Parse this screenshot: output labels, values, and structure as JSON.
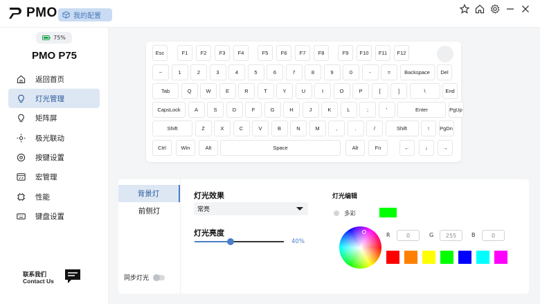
{
  "header": {
    "brand": "PMO",
    "config_label": "我的配置",
    "window_icons": [
      "pin-icon",
      "home-icon",
      "settings-icon",
      "minimize-icon",
      "close-icon"
    ]
  },
  "sidebar": {
    "battery": "75%",
    "device_name": "PMO P75",
    "items": [
      {
        "label": "返回首页",
        "icon": "home-icon"
      },
      {
        "label": "灯光管理",
        "icon": "bulb-icon",
        "active": true
      },
      {
        "label": "矩阵屏",
        "icon": "matrix-bulb-icon"
      },
      {
        "label": "极光联动",
        "icon": "sun-icon"
      },
      {
        "label": "按键设置",
        "icon": "key-settings-icon"
      },
      {
        "label": "宏管理",
        "icon": "macro-icon"
      },
      {
        "label": "性能",
        "icon": "chip-icon"
      },
      {
        "label": "键盘设置",
        "icon": "keyboard-icon"
      }
    ],
    "contact_line1": "联系我们",
    "contact_line2": "Contact Us"
  },
  "keyboard": {
    "rows": [
      [
        "Esc",
        "F1",
        "F2",
        "F3",
        "F4",
        "F5",
        "F6",
        "F7",
        "F8",
        "F9",
        "F10",
        "F11",
        "F12"
      ],
      [
        "~",
        "1",
        "2",
        "3",
        "4",
        "5",
        "6",
        "7",
        "8",
        "9",
        "0",
        "-",
        "=",
        "Backspace",
        "Del"
      ],
      [
        "Tab",
        "Q",
        "W",
        "E",
        "R",
        "T",
        "Y",
        "U",
        "I",
        "O",
        "P",
        "[",
        "]",
        "\\",
        "End"
      ],
      [
        "CapsLock",
        "A",
        "S",
        "D",
        "F",
        "G",
        "H",
        "J",
        "K",
        "L",
        ";",
        "'",
        "Enter",
        "PgUp"
      ],
      [
        "Shift",
        "Z",
        "X",
        "C",
        "V",
        "B",
        "N",
        "M",
        ",",
        ".",
        "/",
        "Shift",
        "↑",
        "PgDn"
      ],
      [
        "Ctrl",
        "Win",
        "Alt",
        "Space",
        "Alt",
        "Fn",
        "←",
        "↓",
        "→"
      ]
    ]
  },
  "panel": {
    "tabs": [
      {
        "label": "背景灯",
        "active": true
      },
      {
        "label": "前侧灯",
        "active": false
      }
    ],
    "sync_label": "同步灯光",
    "effect_title": "灯光效果",
    "effect_value": "常亮",
    "brightness_title": "灯光亮度",
    "brightness_value": 0.4,
    "brightness_label": "40%",
    "color_edit_title": "灯光编辑",
    "multicolor_label": "多彩",
    "current_color": "#00ff00",
    "rgb": {
      "r_label": "R",
      "g_label": "G",
      "b_label": "B",
      "r": "0",
      "g": "255",
      "b": "0"
    },
    "swatches": [
      "#ff0000",
      "#ff8000",
      "#ffff00",
      "#00ff00",
      "#0000ff",
      "#00ffff",
      "#ff00ff"
    ]
  },
  "colors": {
    "accent": "#4a7fc7",
    "active_bg": "#dde7f4"
  }
}
